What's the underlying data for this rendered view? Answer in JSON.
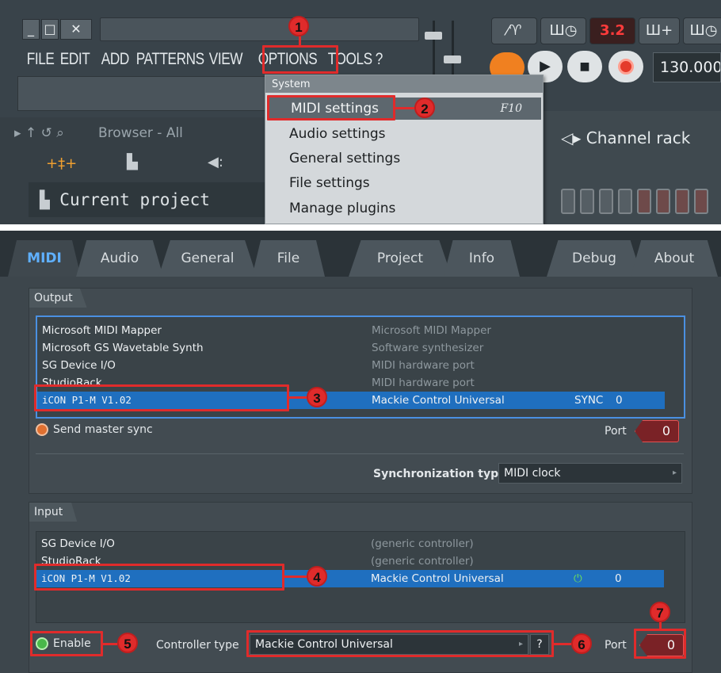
{
  "menu": {
    "items": [
      "FILE",
      "EDIT",
      "ADD",
      "PATTERNS",
      "VIEW",
      "OPTIONS",
      "TOOLS",
      "?"
    ],
    "window_buttons": [
      "_",
      "□",
      "✕"
    ]
  },
  "transport": {
    "pattern_display": "3.2",
    "tempo": "130.000"
  },
  "browser": {
    "header": "Browser - All",
    "current_project": "Current project"
  },
  "channel_rack": {
    "label": "Channel rack"
  },
  "dropdown": {
    "section": "System",
    "items": [
      "MIDI settings",
      "Audio settings",
      "General settings",
      "File settings",
      "Manage plugins"
    ],
    "shortcut": "F10"
  },
  "settings": {
    "tabs": [
      "MIDI",
      "Audio",
      "General",
      "File",
      "Project",
      "Info",
      "Debug",
      "About"
    ],
    "output": {
      "header": "Output",
      "devices": [
        {
          "name": "Microsoft MIDI Mapper",
          "controller": "Microsoft MIDI Mapper"
        },
        {
          "name": "Microsoft GS Wavetable Synth",
          "controller": "Software synthesizer"
        },
        {
          "name": "SG Device I/O",
          "controller": "MIDI hardware port"
        },
        {
          "name": "StudioRack",
          "controller": "MIDI hardware port"
        },
        {
          "name": "iCON P1-M V1.02",
          "controller": "Mackie Control Universal",
          "sync": "SYNC",
          "port": "0"
        }
      ],
      "send_master_sync": "Send master sync",
      "port_label": "Port",
      "port_value": "0",
      "sync_type_label": "Synchronization type",
      "sync_type_value": "MIDI clock"
    },
    "input": {
      "header": "Input",
      "devices": [
        {
          "name": "SG Device I/O",
          "controller": "(generic controller)"
        },
        {
          "name": "StudioRack",
          "controller": "(generic controller)"
        },
        {
          "name": "iCON P1-M V1.02",
          "controller": "Mackie Control Universal",
          "port": "0"
        }
      ],
      "enable_label": "Enable",
      "controller_type_label": "Controller type",
      "controller_type_value": "Mackie Control Universal",
      "help": "?",
      "port_label": "Port",
      "port_value": "0"
    }
  },
  "callouts": [
    "1",
    "2",
    "3",
    "4",
    "5",
    "6",
    "7"
  ],
  "colors": {
    "highlight": "#e02b2b",
    "selection": "#1f6fbf",
    "active_tab": "#5fb0ff",
    "port_bg": "#7a2226"
  }
}
